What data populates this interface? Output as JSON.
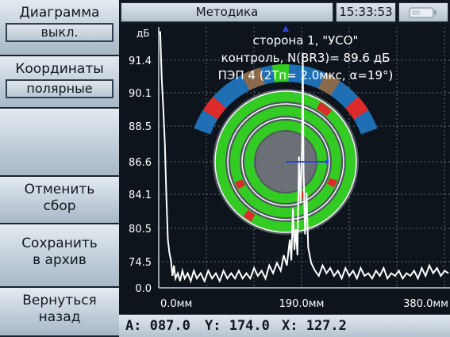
{
  "sidebar": {
    "diagram_label": "Диаграмма",
    "diagram_value": "выкл.",
    "coords_label": "Координаты",
    "coords_value": "полярные",
    "cancel_line1": "Отменить",
    "cancel_line2": "сбор",
    "save_line1": "Сохранить",
    "save_line2": "в архив",
    "back_line1": "Вернуться",
    "back_line2": "назад"
  },
  "topbar": {
    "method": "Методика",
    "time": "15:33:53",
    "battery_icon": "battery-icon"
  },
  "overlay": {
    "line1": "сторона 1, \"УСО\"",
    "line2": "контроль, N(BR3)= 89.6 дБ",
    "line3": "ПЭП 4 (2Тп= 2.0мкс, α=19°)"
  },
  "readout": {
    "a": "A: 087.0",
    "y": "Y: 174.0",
    "x": "X: 127.2"
  },
  "colors": {
    "ring_green": "#33cc22",
    "ring_blue": "#1f6fb5",
    "ring_red": "#dd2a2a",
    "ring_brown": "#8a6a4a",
    "grid": "#5d6c7a",
    "cursor": "#2a45e0"
  },
  "chart_data": {
    "type": "line",
    "y_unit": "дБ",
    "y_ticks": [
      "91.4",
      "90.1",
      "88.5",
      "86.6",
      "84.1",
      "80.5",
      "74.5",
      "0.0"
    ],
    "x_ticks": [
      "0.0мм",
      "190.0мм",
      "380.0мм"
    ],
    "xlim": [
      0,
      380
    ],
    "series": [
      {
        "points": [
          [
            0,
            98
          ],
          [
            2,
            98
          ],
          [
            4,
            80
          ],
          [
            6,
            68
          ],
          [
            8,
            55
          ],
          [
            10,
            35
          ],
          [
            12,
            18
          ],
          [
            14,
            13
          ],
          [
            16,
            10
          ],
          [
            18,
            4
          ],
          [
            20,
            8
          ],
          [
            22,
            3
          ],
          [
            25,
            5
          ],
          [
            28,
            2
          ],
          [
            31,
            6
          ],
          [
            34,
            3
          ],
          [
            38,
            5
          ],
          [
            42,
            2
          ],
          [
            46,
            6
          ],
          [
            50,
            3
          ],
          [
            55,
            5
          ],
          [
            60,
            2
          ],
          [
            65,
            6
          ],
          [
            70,
            3
          ],
          [
            75,
            5
          ],
          [
            80,
            2
          ],
          [
            85,
            6
          ],
          [
            90,
            3
          ],
          [
            95,
            5
          ],
          [
            100,
            3
          ],
          [
            105,
            6
          ],
          [
            110,
            3
          ],
          [
            115,
            5
          ],
          [
            120,
            3
          ],
          [
            125,
            7
          ],
          [
            130,
            4
          ],
          [
            135,
            6
          ],
          [
            140,
            3
          ],
          [
            145,
            8
          ],
          [
            150,
            5
          ],
          [
            155,
            9
          ],
          [
            160,
            6
          ],
          [
            164,
            12
          ],
          [
            168,
            8
          ],
          [
            172,
            18
          ],
          [
            174,
            10
          ],
          [
            176,
            30
          ],
          [
            178,
            14
          ],
          [
            180,
            22
          ],
          [
            182,
            12
          ],
          [
            184,
            50
          ],
          [
            186,
            32
          ],
          [
            188,
            55
          ],
          [
            189,
            90
          ],
          [
            190,
            45
          ],
          [
            192,
            20
          ],
          [
            194,
            36
          ],
          [
            196,
            15
          ],
          [
            198,
            12
          ],
          [
            200,
            9
          ],
          [
            205,
            6
          ],
          [
            210,
            4
          ],
          [
            215,
            8
          ],
          [
            220,
            5
          ],
          [
            225,
            7
          ],
          [
            230,
            4
          ],
          [
            235,
            6
          ],
          [
            240,
            3
          ],
          [
            245,
            7
          ],
          [
            250,
            4
          ],
          [
            255,
            6
          ],
          [
            260,
            3
          ],
          [
            265,
            7
          ],
          [
            270,
            4
          ],
          [
            275,
            5
          ],
          [
            280,
            3
          ],
          [
            285,
            6
          ],
          [
            290,
            4
          ],
          [
            295,
            7
          ],
          [
            300,
            3
          ],
          [
            305,
            5
          ],
          [
            310,
            4
          ],
          [
            315,
            6
          ],
          [
            320,
            3
          ],
          [
            325,
            5
          ],
          [
            330,
            4
          ],
          [
            335,
            6
          ],
          [
            340,
            3
          ],
          [
            345,
            7
          ],
          [
            350,
            4
          ],
          [
            355,
            8
          ],
          [
            360,
            5
          ],
          [
            365,
            7
          ],
          [
            370,
            4
          ],
          [
            375,
            6
          ],
          [
            380,
            5
          ]
        ]
      }
    ]
  }
}
